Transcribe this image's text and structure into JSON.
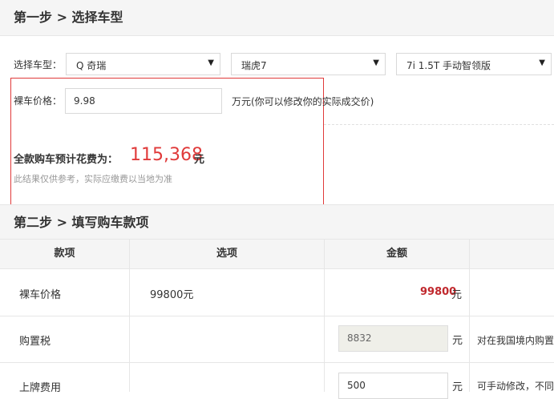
{
  "step1": {
    "title": "第一步 > 选择车型"
  },
  "select": {
    "label": "选择车型：",
    "brand": "Q 奇瑞",
    "series": "瑞虎7",
    "model": "7i 1.5T 手动智领版"
  },
  "price": {
    "label": "裸车价格：",
    "value": "9.98",
    "unit_note": "万元(你可以修改你的实际成交价)"
  },
  "total": {
    "label": "全款购车预计花费为：",
    "value": "115,368",
    "unit": "元",
    "note": "此结果仅供参考，实际应缴费以当地为准"
  },
  "step2": {
    "title": "第二步 > 填写购车款项"
  },
  "table": {
    "headers": [
      "款项",
      "选项",
      "金额"
    ],
    "rows": [
      {
        "name": "裸车价格",
        "option": "99800元",
        "amount": "99800",
        "unit": "元",
        "remark": ""
      },
      {
        "name": "购置税",
        "option": "",
        "amount": "8832",
        "unit": "元",
        "remark": "对在我国境内购置"
      },
      {
        "name": "上牌费用",
        "option": "",
        "amount": "500",
        "unit": "元",
        "remark": "可手动修改，不同"
      }
    ]
  },
  "colors": {
    "accent": "#e03a3a",
    "price_red": "#c0282d"
  }
}
